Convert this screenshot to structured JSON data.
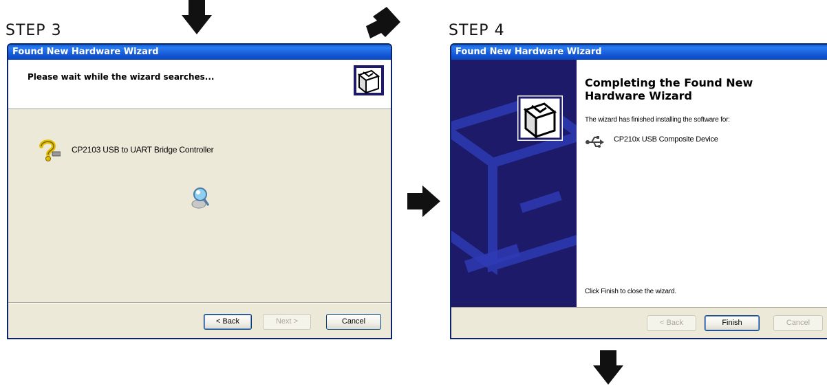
{
  "steps": {
    "left_label": "STEP 3",
    "right_label": "STEP 4"
  },
  "step3_window": {
    "title": "Found New Hardware Wizard",
    "header_text": "Please wait while the wizard searches...",
    "device_name": "CP2103 USB to UART Bridge Controller",
    "buttons": {
      "back": "< Back",
      "next": "Next >",
      "cancel": "Cancel"
    }
  },
  "step4_window": {
    "title": "Found New Hardware Wizard",
    "heading_line1": "Completing the Found New",
    "heading_line2": "Hardware Wizard",
    "info_text": "The wizard has finished installing the software for:",
    "device_name": "CP210x USB Composite Device",
    "finish_text": "Click Finish to close the wizard.",
    "buttons": {
      "back": "< Back",
      "finish": "Finish",
      "cancel": "Cancel"
    }
  },
  "colors": {
    "titlebar": "#1356d4",
    "window_bg": "#ece9d8",
    "sidebar": "#1d1a6a",
    "arrow": "#111111"
  }
}
